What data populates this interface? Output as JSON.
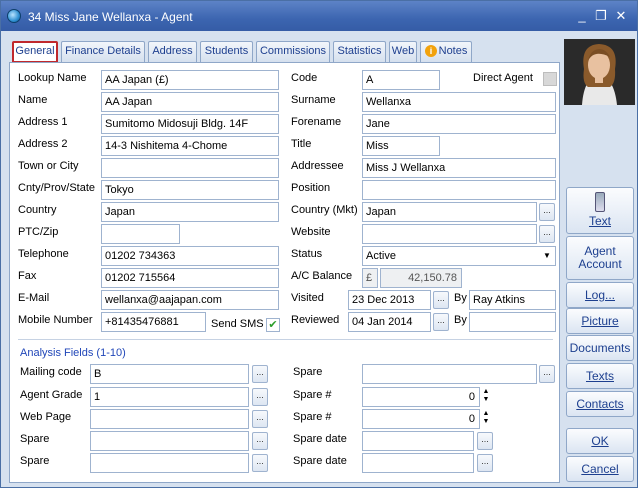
{
  "window": {
    "title": "34 Miss Jane Wellanxa - Agent",
    "min": "_",
    "restore": "❐",
    "close": "✕"
  },
  "tabs": [
    "General",
    "Finance Details",
    "Address",
    "Students",
    "Commissions",
    "Statistics",
    "Web",
    "Notes"
  ],
  "general": {
    "lookup_name": {
      "label": "Lookup Name",
      "value": "AA Japan (£)"
    },
    "name": {
      "label": "Name",
      "value": "AA Japan"
    },
    "address1": {
      "label": "Address 1",
      "value": "Sumitomo Midosuji Bldg. 14F"
    },
    "address2": {
      "label": "Address 2",
      "value": "14-3 Nishitema 4-Chome"
    },
    "town": {
      "label": "Town or City",
      "value": ""
    },
    "county": {
      "label": "Cnty/Prov/State",
      "value": "Tokyo"
    },
    "country": {
      "label": "Country",
      "value": "Japan"
    },
    "ptc": {
      "label": "PTC/Zip",
      "value": ""
    },
    "telephone": {
      "label": "Telephone",
      "value": "01202 734363"
    },
    "fax": {
      "label": "Fax",
      "value": "01202 715564"
    },
    "email": {
      "label": "E-Mail",
      "value": "wellanxa@aajapan.com"
    },
    "mobile": {
      "label": "Mobile Number",
      "value": "+81435476881"
    },
    "send_sms": {
      "label": "Send SMS",
      "checked": true
    },
    "code": {
      "label": "Code",
      "value": "A"
    },
    "direct_agent": {
      "label": "Direct Agent",
      "checked": false
    },
    "surname": {
      "label": "Surname",
      "value": "Wellanxa"
    },
    "forename": {
      "label": "Forename",
      "value": "Jane"
    },
    "title": {
      "label": "Title",
      "value": "Miss"
    },
    "addressee": {
      "label": "Addressee",
      "value": "Miss J Wellanxa"
    },
    "position": {
      "label": "Position",
      "value": ""
    },
    "country_mkt": {
      "label": "Country (Mkt)",
      "value": "Japan"
    },
    "website": {
      "label": "Website",
      "value": ""
    },
    "status": {
      "label": "Status",
      "value": "Active"
    },
    "ac_balance": {
      "label": "A/C Balance",
      "currency": "£",
      "value": "42,150.78"
    },
    "visited": {
      "label": "Visited",
      "date": "23 Dec 2013",
      "by_label": "By",
      "by": "Ray Atkins"
    },
    "reviewed": {
      "label": "Reviewed",
      "date": "04 Jan 2014",
      "by_label": "By",
      "by": ""
    }
  },
  "analysis": {
    "heading": "Analysis Fields (1-10)",
    "mailing_code": {
      "label": "Mailing code",
      "value": "B"
    },
    "agent_grade": {
      "label": "Agent Grade",
      "value": "1"
    },
    "web_page": {
      "label": "Web Page",
      "value": ""
    },
    "spare1": {
      "label": "Spare",
      "value": ""
    },
    "spare2": {
      "label": "Spare",
      "value": ""
    },
    "r_spare": {
      "label": "Spare",
      "value": ""
    },
    "spare_num1": {
      "label": "Spare #",
      "value": "0"
    },
    "spare_num2": {
      "label": "Spare #",
      "value": "0"
    },
    "spare_date1": {
      "label": "Spare date",
      "value": ""
    },
    "spare_date2": {
      "label": "Spare date",
      "value": ""
    }
  },
  "side": {
    "text": "Text",
    "agent_account": "Agent Account",
    "log": "Log...",
    "picture": "Picture",
    "documents": "Documents",
    "texts": "Texts",
    "contacts": "Contacts",
    "ok": "OK",
    "cancel": "Cancel"
  },
  "icons": {
    "ellipsis": "...",
    "dropdown": "▼",
    "spin_up": "▲",
    "spin_down": "▼",
    "check": "✔"
  }
}
